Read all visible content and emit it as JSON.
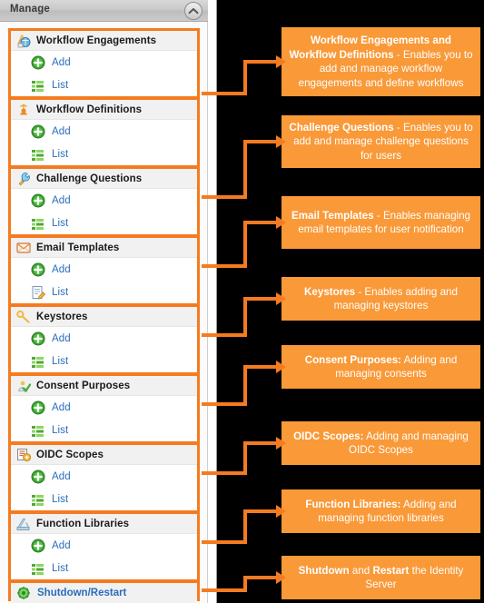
{
  "panel": {
    "title": "Manage",
    "collapse_icon": "chevron-up-icon",
    "groups": [
      {
        "id": "workflow-engagements",
        "icon": "workflow-engagements-icon",
        "label": "Workflow Engagements",
        "items": [
          {
            "icon": "add-plus-icon",
            "label": "Add"
          },
          {
            "icon": "list-icon",
            "label": "List"
          }
        ]
      },
      {
        "id": "workflow-definitions",
        "icon": "workflow-definitions-icon",
        "label": "Workflow Definitions",
        "items": [
          {
            "icon": "add-plus-icon",
            "label": "Add"
          },
          {
            "icon": "list-icon",
            "label": "List"
          }
        ]
      },
      {
        "id": "challenge-questions",
        "icon": "challenge-questions-icon",
        "label": "Challenge Questions",
        "items": [
          {
            "icon": "add-plus-icon",
            "label": "Add"
          },
          {
            "icon": "list-icon",
            "label": "List"
          }
        ]
      },
      {
        "id": "email-templates",
        "icon": "email-envelope-icon",
        "label": "Email Templates",
        "items": [
          {
            "icon": "add-plus-icon",
            "label": "Add"
          },
          {
            "icon": "edit-document-icon",
            "label": "List"
          }
        ]
      },
      {
        "id": "keystores",
        "icon": "key-icon",
        "label": "Keystores",
        "items": [
          {
            "icon": "add-plus-icon",
            "label": "Add"
          },
          {
            "icon": "list-icon",
            "label": "List"
          }
        ]
      },
      {
        "id": "consent-purposes",
        "icon": "consent-check-icon",
        "label": "Consent Purposes",
        "items": [
          {
            "icon": "add-plus-icon",
            "label": "Add"
          },
          {
            "icon": "list-icon",
            "label": "List"
          }
        ]
      },
      {
        "id": "oidc-scopes",
        "icon": "oidc-scopes-icon",
        "label": "OIDC Scopes",
        "items": [
          {
            "icon": "add-plus-icon",
            "label": "Add"
          },
          {
            "icon": "list-icon",
            "label": "List"
          }
        ]
      },
      {
        "id": "function-libraries",
        "icon": "function-libraries-icon",
        "label": "Function Libraries",
        "items": [
          {
            "icon": "add-plus-icon",
            "label": "Add"
          },
          {
            "icon": "list-icon",
            "label": "List"
          }
        ]
      }
    ],
    "shutdown": {
      "id": "shutdown-restart",
      "icon": "gear-icon",
      "label": "Shutdown/Restart"
    }
  },
  "callouts": [
    {
      "id": "callout-workflow",
      "bold_1": "Workflow Engagements and Workflow Definitions",
      "rest_1": " - Enables you to add and manage workflow engagements and define workflows"
    },
    {
      "id": "callout-challenge-questions",
      "bold_1": "Challenge Questions",
      "rest_1": " -  Enables you to add and manage challenge questions for users"
    },
    {
      "id": "callout-email-templates",
      "bold_1": "Email Templates",
      "rest_1": " - Enables managing email templates for user notification"
    },
    {
      "id": "callout-keystores",
      "bold_1": "Keystores",
      "rest_1": " -  Enables adding and managing keystores"
    },
    {
      "id": "callout-consent-purposes",
      "bold_1": "Consent Purposes:",
      "rest_1": "  Adding and managing consents"
    },
    {
      "id": "callout-oidc-scopes",
      "bold_1": "OIDC Scopes:",
      "rest_1": " Adding and managing OIDC Scopes"
    },
    {
      "id": "callout-function-libraries",
      "bold_1": "Function Libraries:",
      "rest_1": " Adding and managing function libraries"
    },
    {
      "id": "callout-shutdown-restart",
      "bold_1": "Shutdown",
      "mid_1": " and ",
      "bold_2": "Restart",
      "rest_1": " the Identity Server"
    }
  ],
  "colors": {
    "accent_orange": "#f47b20",
    "callout_bg": "#f99938",
    "link_blue": "#2a6ebb",
    "background": "#000000"
  }
}
